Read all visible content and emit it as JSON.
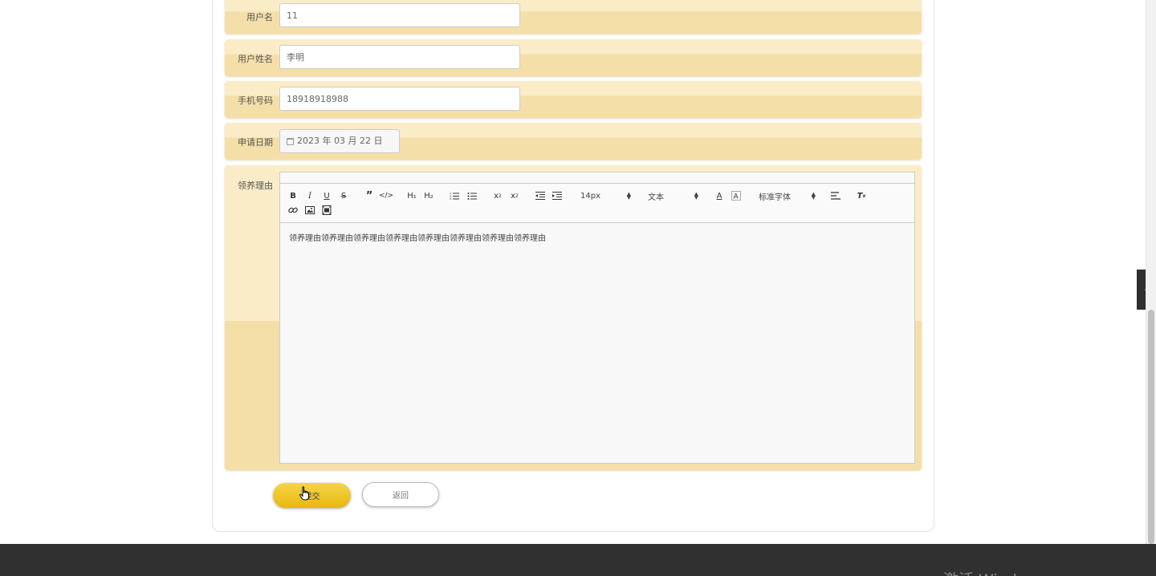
{
  "form": {
    "username": {
      "label": "用户名",
      "value": "11"
    },
    "fullname": {
      "label": "用户姓名",
      "value": "李明"
    },
    "phone": {
      "label": "手机号码",
      "value": "18918918988"
    },
    "apply_date": {
      "label": "申请日期",
      "value": "2023 年 03 月 22 日"
    },
    "reason": {
      "label": "领养理由",
      "content": "领养理由领养理由领养理由领养理由领养理由领养理由领养理由领养理由"
    }
  },
  "toolbar": {
    "h1": "H₁",
    "h2": "H₂",
    "font_size": "14px",
    "header_select": "文本",
    "font_family": "标准字体"
  },
  "buttons": {
    "submit": "提交",
    "back": "返回"
  },
  "footer": {
    "watermark": "激活 Windows"
  }
}
